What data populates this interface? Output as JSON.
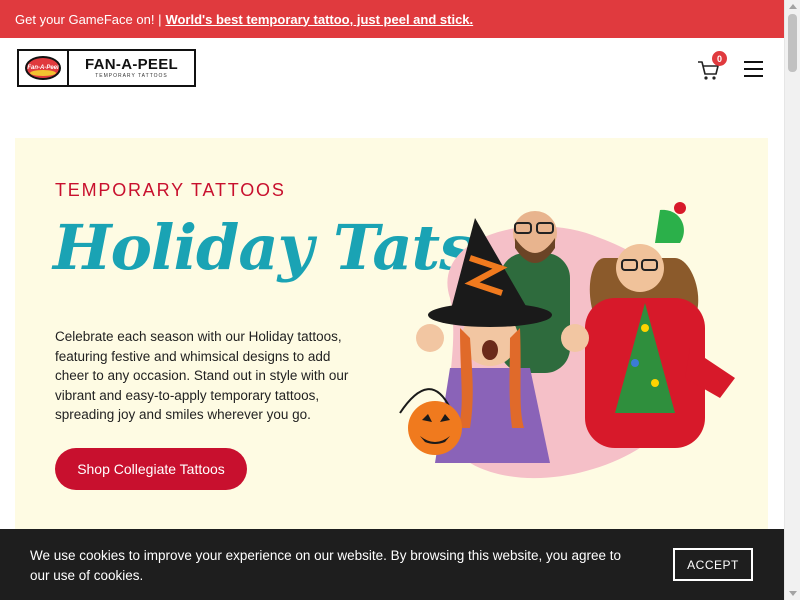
{
  "promo": {
    "text": "Get your GameFace on! |",
    "link": "World's best temporary tattoo, just peel and stick."
  },
  "header": {
    "logo_mark": "Fan-A-Peel",
    "logo_name": "FAN-A-PEEL",
    "logo_sub": "TEMPORARY TATTOOS",
    "cart_count": "0",
    "cart_icon": "cart-icon",
    "menu_icon": "hamburger-menu-icon"
  },
  "hero": {
    "eyebrow": "TEMPORARY TATTOOS",
    "title": "Holiday Tats",
    "description": "Celebrate each season with our Holiday tattoos, featuring festive and whimsical designs to add cheer to any occasion. Stand out in style with our vibrant and easy-to-apply temporary tattoos, spreading joy and smiles wherever you go.",
    "cta": "Shop Collegiate Tattoos"
  },
  "cookie": {
    "text": "We use cookies to improve your experience on our website. By browsing this website, you agree to our use of cookies.",
    "accept": "ACCEPT"
  },
  "colors": {
    "promo_bg": "#e03a3e",
    "brand_red": "#c8102e",
    "title_teal": "#1aa3b4",
    "hero_bg": "#fefbe3",
    "cookie_bg": "#1e1e1e"
  }
}
